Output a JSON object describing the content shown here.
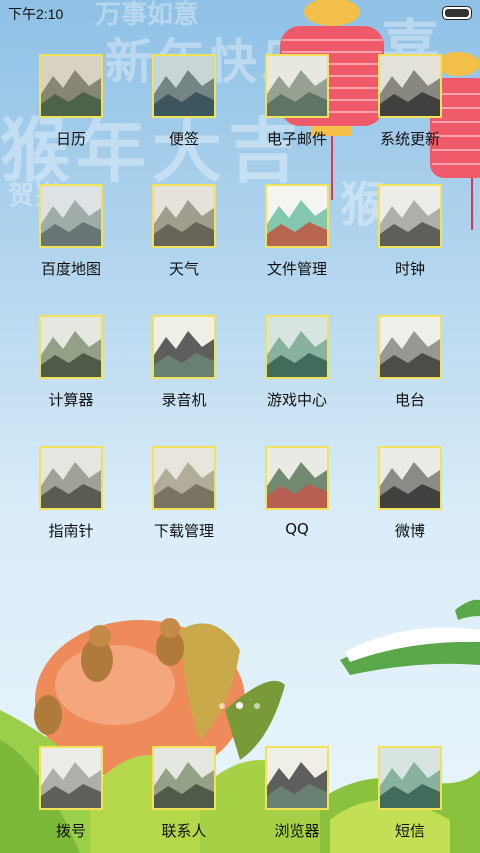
{
  "status_bar": {
    "time": "下午2:10"
  },
  "background": {
    "phrases": [
      "万事如意",
      "新年快乐",
      "猴年大吉",
      "贺岁",
      "猴",
      "喜"
    ]
  },
  "apps": [
    {
      "label": "日历",
      "icon": "calendar-icon"
    },
    {
      "label": "便签",
      "icon": "notes-icon"
    },
    {
      "label": "电子邮件",
      "icon": "email-icon"
    },
    {
      "label": "系统更新",
      "icon": "system-update-icon"
    },
    {
      "label": "百度地图",
      "icon": "baidu-map-icon"
    },
    {
      "label": "天气",
      "icon": "weather-icon"
    },
    {
      "label": "文件管理",
      "icon": "file-manager-icon"
    },
    {
      "label": "时钟",
      "icon": "clock-icon"
    },
    {
      "label": "计算器",
      "icon": "calculator-icon"
    },
    {
      "label": "录音机",
      "icon": "recorder-icon"
    },
    {
      "label": "游戏中心",
      "icon": "game-center-icon"
    },
    {
      "label": "电台",
      "icon": "radio-icon"
    },
    {
      "label": "指南针",
      "icon": "compass-icon"
    },
    {
      "label": "下载管理",
      "icon": "download-manager-icon"
    },
    {
      "label": "QQ",
      "icon": "qq-icon"
    },
    {
      "label": "微博",
      "icon": "weibo-icon"
    }
  ],
  "dock": [
    {
      "label": "拨号",
      "icon": "dialer-icon"
    },
    {
      "label": "联系人",
      "icon": "contacts-icon"
    },
    {
      "label": "浏览器",
      "icon": "browser-icon"
    },
    {
      "label": "短信",
      "icon": "messages-icon"
    }
  ],
  "pager": {
    "pages": 3,
    "current": 2
  }
}
